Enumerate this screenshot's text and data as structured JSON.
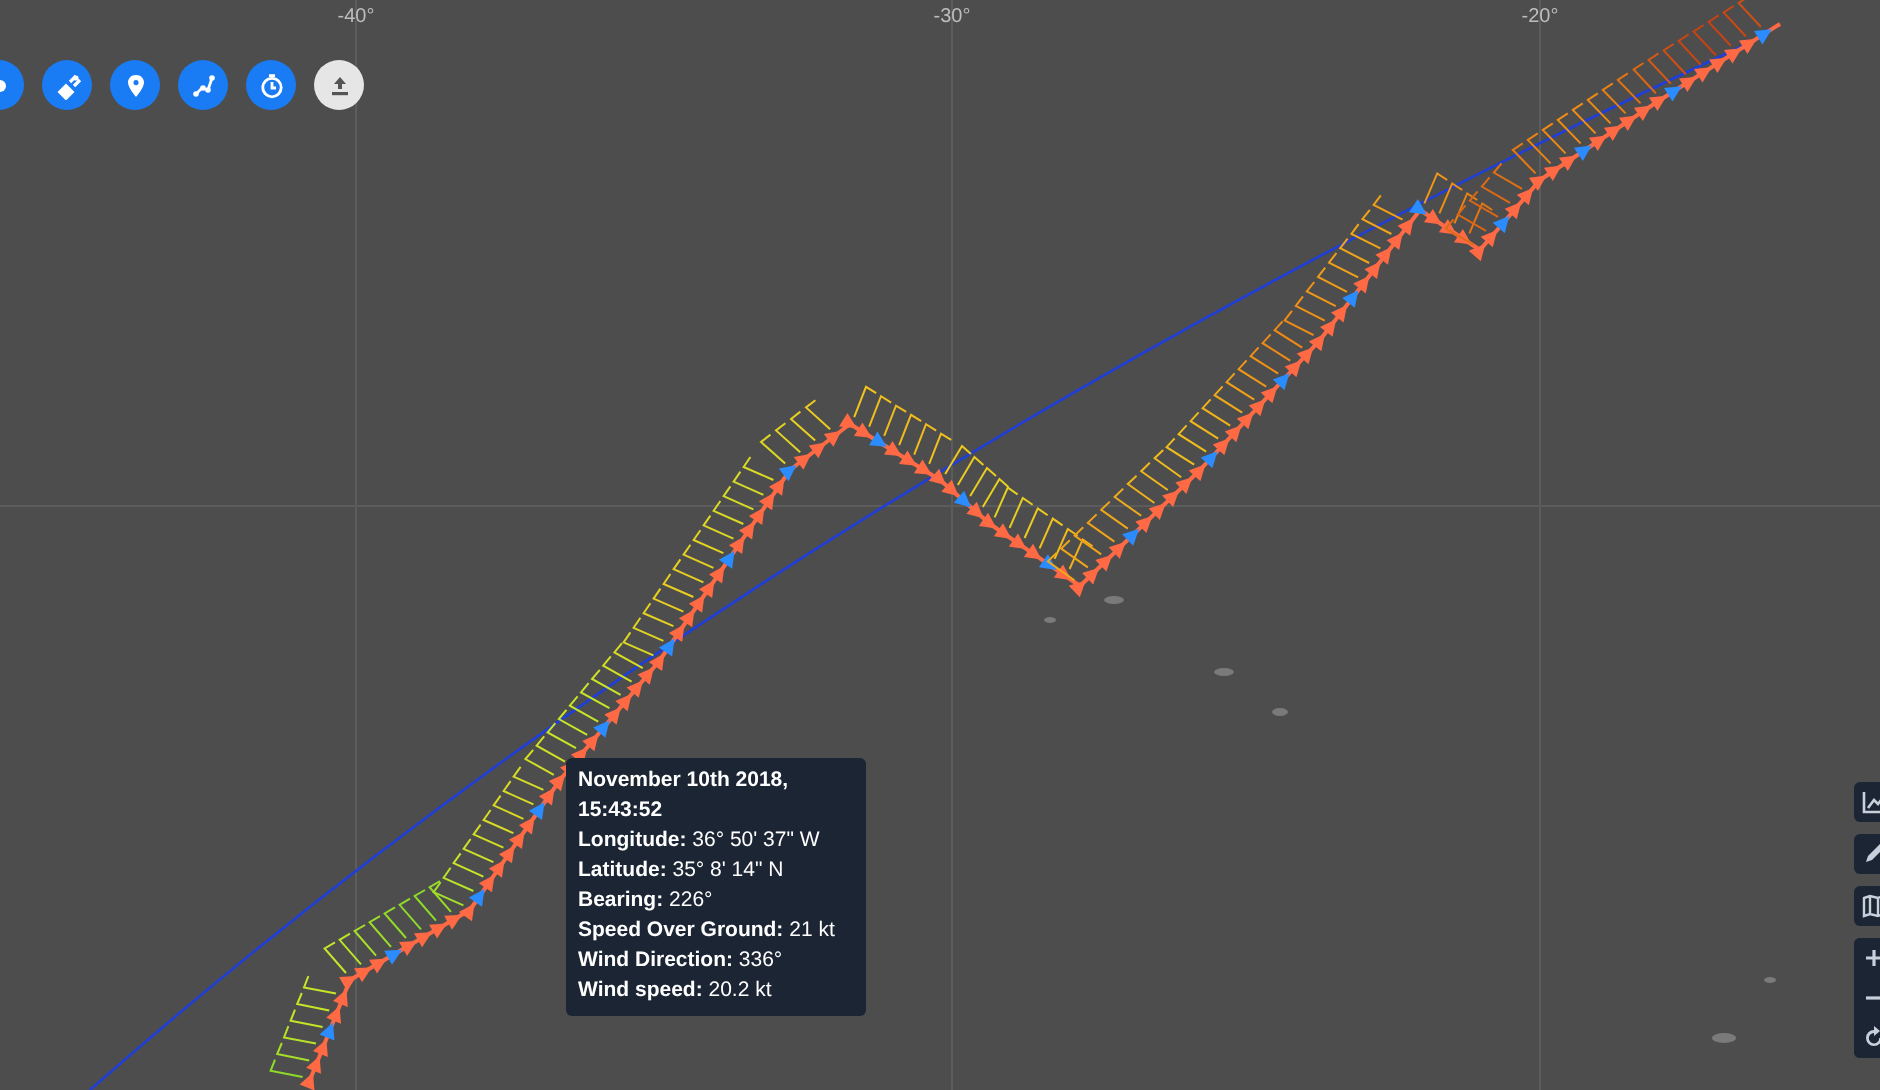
{
  "map": {
    "longitude_labels": [
      "-40°",
      "-30°",
      "-20°"
    ]
  },
  "toolbar": [
    {
      "kind": "partial",
      "disabled": false
    },
    {
      "kind": "satellite",
      "disabled": false
    },
    {
      "kind": "pin",
      "disabled": false
    },
    {
      "kind": "route",
      "disabled": false
    },
    {
      "kind": "timer",
      "disabled": false
    },
    {
      "kind": "upload",
      "disabled": true
    }
  ],
  "tooltip": {
    "title": "November 10th 2018, 15:43:52",
    "rows": [
      {
        "label": "Longitude:",
        "value": "36° 50' 37\" W"
      },
      {
        "label": "Latitude:",
        "value": "35° 8' 14\" N"
      },
      {
        "label": "Bearing:",
        "value": "226°"
      },
      {
        "label": "Speed Over Ground:",
        "value": "21 kt"
      },
      {
        "label": "Wind Direction:",
        "value": "336°"
      },
      {
        "label": "Wind speed:",
        "value": "20.2 kt"
      }
    ]
  },
  "side_controls": [
    {
      "kind": "chart"
    },
    {
      "kind": "pen"
    },
    {
      "kind": "map"
    },
    {
      "kind": "zoom-in"
    },
    {
      "kind": "zoom-out"
    },
    {
      "kind": "rotate"
    }
  ]
}
